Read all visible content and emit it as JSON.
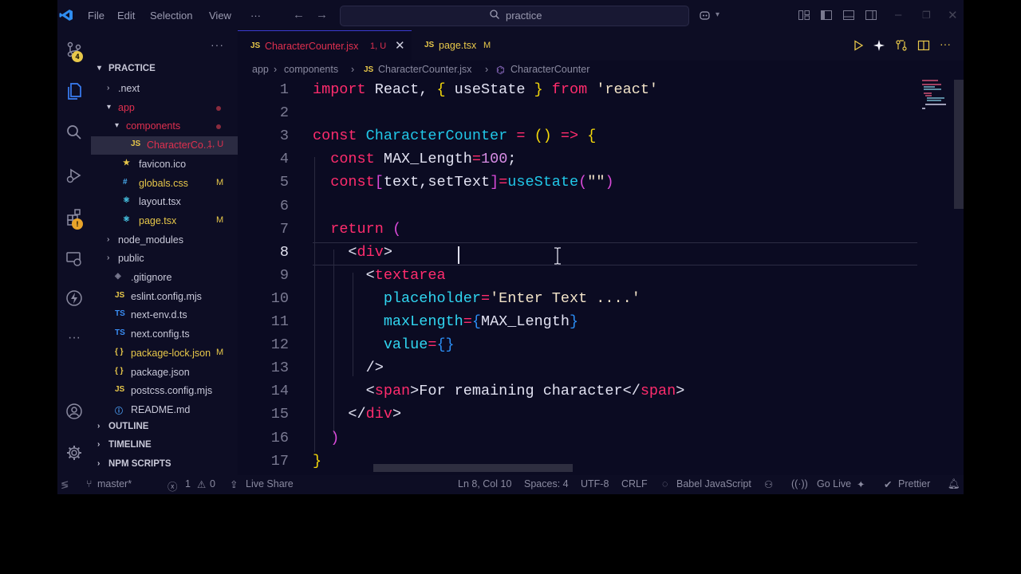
{
  "titlebar": {
    "menu": [
      "File",
      "Edit",
      "Selection",
      "View"
    ],
    "more": "···",
    "search_text": "practice"
  },
  "activity": {
    "source_control_badge": "4",
    "extensions_badge": "!",
    "more": "···"
  },
  "explorer": {
    "more": "···",
    "root": "PRACTICE",
    "items": [
      {
        "name": ".next",
        "kind": "folder",
        "expanded": false,
        "indent": 0,
        "mark": "",
        "color": "#c8c8d8"
      },
      {
        "name": "app",
        "kind": "folder",
        "expanded": true,
        "indent": 0,
        "mark": "dot",
        "color": "#e0304f"
      },
      {
        "name": "components",
        "kind": "folder",
        "expanded": true,
        "indent": 1,
        "mark": "dot",
        "color": "#e0304f"
      },
      {
        "name": "CharacterCo...",
        "kind": "js",
        "indent": 2,
        "mark": "1, U",
        "color": "#e0304f",
        "selected": true
      },
      {
        "name": "favicon.ico",
        "kind": "star",
        "indent": 1,
        "mark": "",
        "color": "#c8c8d8"
      },
      {
        "name": "globals.css",
        "kind": "css",
        "indent": 1,
        "mark": "M",
        "color": "#e8c84a"
      },
      {
        "name": "layout.tsx",
        "kind": "react",
        "indent": 1,
        "mark": "",
        "color": "#c8c8d8"
      },
      {
        "name": "page.tsx",
        "kind": "react",
        "indent": 1,
        "mark": "M",
        "color": "#e8c84a"
      },
      {
        "name": "node_modules",
        "kind": "folder",
        "expanded": false,
        "indent": 0,
        "mark": "",
        "color": "#c8c8d8"
      },
      {
        "name": "public",
        "kind": "folder",
        "expanded": false,
        "indent": 0,
        "mark": "",
        "color": "#c8c8d8"
      },
      {
        "name": ".gitignore",
        "kind": "git",
        "indent": 0,
        "mark": "",
        "color": "#c8c8d8"
      },
      {
        "name": "eslint.config.mjs",
        "kind": "js",
        "indent": 0,
        "mark": "",
        "color": "#c8c8d8"
      },
      {
        "name": "next-env.d.ts",
        "kind": "ts",
        "indent": 0,
        "mark": "",
        "color": "#c8c8d8"
      },
      {
        "name": "next.config.ts",
        "kind": "ts",
        "indent": 0,
        "mark": "",
        "color": "#c8c8d8"
      },
      {
        "name": "package-lock.json",
        "kind": "json",
        "indent": 0,
        "mark": "M",
        "color": "#e8c84a"
      },
      {
        "name": "package.json",
        "kind": "json",
        "indent": 0,
        "mark": "",
        "color": "#c8c8d8"
      },
      {
        "name": "postcss.config.mjs",
        "kind": "js",
        "indent": 0,
        "mark": "",
        "color": "#c8c8d8"
      },
      {
        "name": "README.md",
        "kind": "info",
        "indent": 0,
        "mark": "",
        "color": "#c8c8d8"
      }
    ],
    "sections": [
      "OUTLINE",
      "TIMELINE",
      "NPM SCRIPTS"
    ]
  },
  "tabs": [
    {
      "icon": "JS",
      "label": "CharacterCounter.jsx",
      "status": "1, U",
      "active": true
    },
    {
      "icon": "JS",
      "label": "page.tsx",
      "status": "M",
      "active": false
    }
  ],
  "breadcrumb": [
    "app",
    "components",
    "CharacterCounter.jsx",
    "CharacterCounter"
  ],
  "code": {
    "cursor_line": 8,
    "lines": [
      [
        [
          "kw",
          "import "
        ],
        [
          "id",
          "React, "
        ],
        [
          "br1",
          "{ "
        ],
        [
          "id",
          "useState "
        ],
        [
          "br1",
          "} "
        ],
        [
          "kw",
          "from "
        ],
        [
          "str",
          "'react'"
        ]
      ],
      [],
      [
        [
          "kw",
          "const "
        ],
        [
          "fn",
          "CharacterCounter "
        ],
        [
          "op",
          "= "
        ],
        [
          "br1",
          "() "
        ],
        [
          "op",
          "=> "
        ],
        [
          "br1",
          "{"
        ]
      ],
      [
        [
          "pad",
          "  "
        ],
        [
          "kw",
          "const "
        ],
        [
          "id",
          "MAX_Length"
        ],
        [
          "op",
          "="
        ],
        [
          "num",
          "100"
        ],
        [
          "id",
          ";"
        ]
      ],
      [
        [
          "pad",
          "  "
        ],
        [
          "kw",
          "const"
        ],
        [
          "br2",
          "["
        ],
        [
          "id",
          "text,setText"
        ],
        [
          "br2",
          "]"
        ],
        [
          "op",
          "="
        ],
        [
          "fn",
          "useState"
        ],
        [
          "br2",
          "("
        ],
        [
          "str",
          "\"\""
        ],
        [
          "br2",
          ")"
        ]
      ],
      [],
      [
        [
          "pad",
          "  "
        ],
        [
          "kw",
          "return "
        ],
        [
          "br2",
          "("
        ]
      ],
      [
        [
          "pad",
          "    "
        ],
        [
          "pct",
          "<"
        ],
        [
          "tag",
          "div"
        ],
        [
          "pct",
          ">"
        ]
      ],
      [
        [
          "pad",
          "      "
        ],
        [
          "pct",
          "<"
        ],
        [
          "tag",
          "textarea"
        ]
      ],
      [
        [
          "pad",
          "        "
        ],
        [
          "attr",
          "placeholder"
        ],
        [
          "op",
          "="
        ],
        [
          "str",
          "'Enter Text ....'"
        ]
      ],
      [
        [
          "pad",
          "        "
        ],
        [
          "attr",
          "maxLength"
        ],
        [
          "op",
          "="
        ],
        [
          "br3",
          "{"
        ],
        [
          "id",
          "MAX_Length"
        ],
        [
          "br3",
          "}"
        ]
      ],
      [
        [
          "pad",
          "        "
        ],
        [
          "attr",
          "value"
        ],
        [
          "op",
          "="
        ],
        [
          "br3",
          "{}"
        ]
      ],
      [
        [
          "pad",
          "      "
        ],
        [
          "pct",
          "/>"
        ]
      ],
      [
        [
          "pad",
          "      "
        ],
        [
          "pct",
          "<"
        ],
        [
          "tag",
          "span"
        ],
        [
          "pct",
          ">"
        ],
        [
          "id",
          "For remaining character"
        ],
        [
          "pct",
          "</"
        ],
        [
          "tag",
          "span"
        ],
        [
          "pct",
          ">"
        ]
      ],
      [
        [
          "pad",
          "    "
        ],
        [
          "pct",
          "</"
        ],
        [
          "tag",
          "div"
        ],
        [
          "pct",
          ">"
        ]
      ],
      [
        [
          "pad",
          "  "
        ],
        [
          "br2",
          ")"
        ]
      ],
      [
        [
          "br1",
          "}"
        ]
      ]
    ]
  },
  "status": {
    "branch": "master*",
    "errors": "1",
    "warnings": "0",
    "live_share": "Live Share",
    "position": "Ln 8, Col 10",
    "spaces": "Spaces: 4",
    "encoding": "UTF-8",
    "eol": "CRLF",
    "language": "Babel JavaScript",
    "go_live": "Go Live",
    "prettier": "Prettier"
  },
  "colors": {
    "background": "#0b0b22",
    "chrome": "#0d0d24",
    "accent": "#3a3ad0",
    "error": "#e0304f",
    "modified": "#e8c84a"
  }
}
